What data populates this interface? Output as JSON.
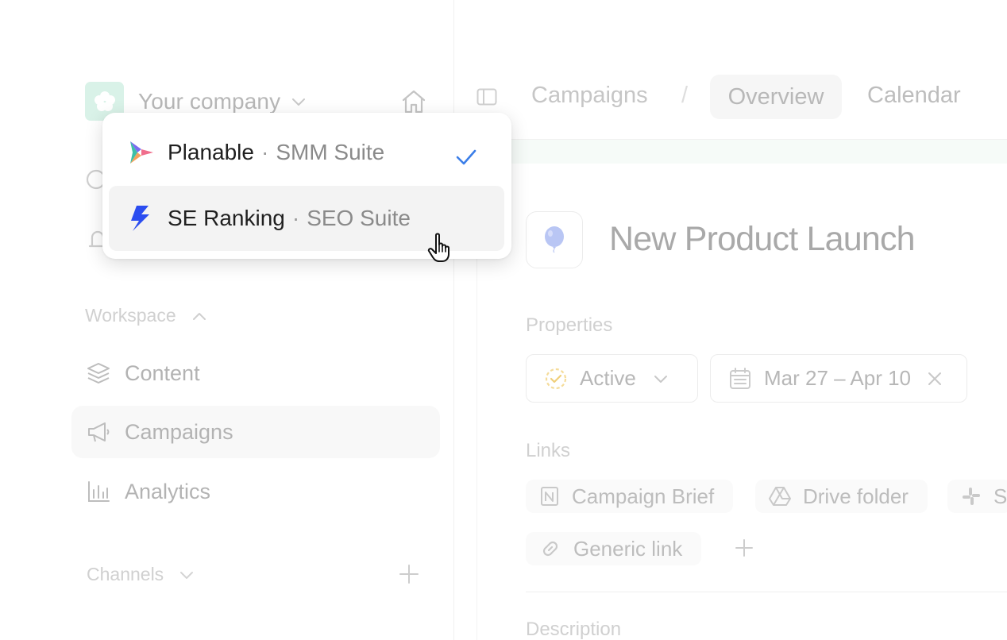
{
  "sidebar": {
    "company_name": "Your company",
    "workspace_header": "Workspace",
    "channels_header": "Channels",
    "nav": {
      "content": "Content",
      "campaigns": "Campaigns",
      "analytics": "Analytics"
    }
  },
  "breadcrumb": {
    "campaigns": "Campaigns",
    "separator": "/"
  },
  "tabs": {
    "overview": "Overview",
    "calendar": "Calendar"
  },
  "page": {
    "title": "New Product Launch",
    "properties_label": "Properties",
    "status": "Active",
    "date_range": "Mar 27 – Apr 10",
    "links_label": "Links",
    "links": {
      "campaign_brief": "Campaign Brief",
      "drive_folder": "Drive folder",
      "slack_partial": "S",
      "generic_link": "Generic link"
    },
    "description_label": "Description"
  },
  "switcher": {
    "items": [
      {
        "name": "Planable",
        "separator": "·",
        "suite": "SMM Suite",
        "selected": true
      },
      {
        "name": "SE Ranking",
        "separator": "·",
        "suite": "SEO Suite",
        "selected": false
      }
    ]
  },
  "colors": {
    "accent_check": "#3b7ee8",
    "se_ranking_blue": "#2b4df0",
    "company_logo_bg": "#d9f2e8",
    "balloon": "#b9c6f4",
    "status_ring": "#f5dc9a"
  }
}
